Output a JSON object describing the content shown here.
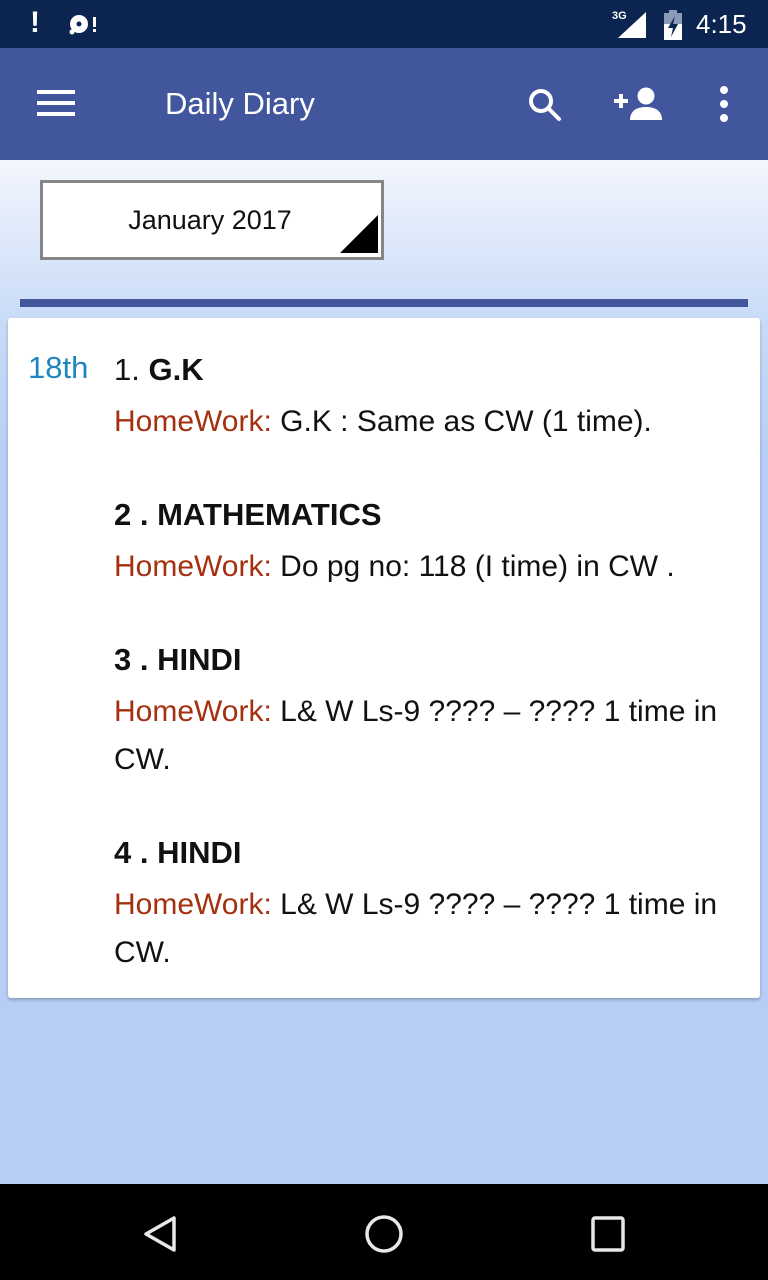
{
  "status_bar": {
    "notification_icons": [
      "alert-icon",
      "disc-alert-icon"
    ],
    "network_type": "3G",
    "time": "4:15"
  },
  "app_bar": {
    "title": "Daily Diary",
    "actions": [
      "menu-icon",
      "search-icon",
      "add-user-icon",
      "more-vert-icon"
    ]
  },
  "month_selector": {
    "selected": "January 2017"
  },
  "colors": {
    "primary": "#42569e",
    "status_bar": "#0c2550",
    "day_label": "#1f86bd",
    "homework_label": "#a4300f",
    "background": "#b6cef5"
  },
  "diary": {
    "day": "18th",
    "entries": [
      {
        "number": "1. ",
        "subject": "G.K",
        "homework_label": "HomeWork:",
        "homework_text": " G.K : Same as CW (1 time)."
      },
      {
        "number": "2 . ",
        "subject": "MATHEMATICS",
        "homework_label": "HomeWork:",
        "homework_text": " Do pg no: 118 (I time) in CW ."
      },
      {
        "number": "3 . ",
        "subject": "HINDI",
        "homework_label": "HomeWork:",
        "homework_text": " L& W Ls-9 ???? – ???? 1 time in CW."
      },
      {
        "number": "4 . ",
        "subject": "HINDI",
        "homework_label": "HomeWork:",
        "homework_text": " L& W Ls-9 ???? – ???? 1 time in CW."
      }
    ]
  },
  "nav_bar": {
    "buttons": [
      "back-icon",
      "home-icon",
      "recents-icon"
    ]
  }
}
